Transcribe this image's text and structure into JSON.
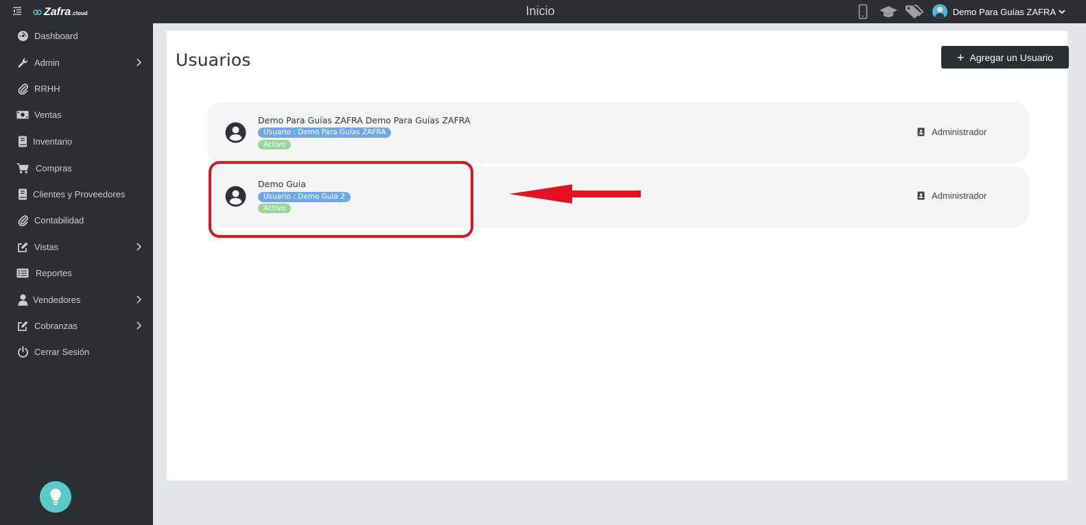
{
  "topbar": {
    "logo_text": "Zafra",
    "logo_suffix": ".cloud",
    "page_heading": "Inicio",
    "icons": [
      "mobile-icon",
      "graduation-cap-icon",
      "tags-icon"
    ],
    "user_name": "Demo Para Guías ZAFRA"
  },
  "sidebar": {
    "items": [
      {
        "label": "Dashboard",
        "icon": "dashboard-icon",
        "has_submenu": false
      },
      {
        "label": "Admin",
        "icon": "wrench-icon",
        "has_submenu": true
      },
      {
        "label": "RRHH",
        "icon": "paperclip-icon",
        "has_submenu": false
      },
      {
        "label": "Ventas",
        "icon": "money-icon",
        "has_submenu": false
      },
      {
        "label": "Inventario",
        "icon": "book-icon",
        "has_submenu": false
      },
      {
        "label": "Compras",
        "icon": "cart-icon",
        "has_submenu": false
      },
      {
        "label": "Clientes y Proveedores",
        "icon": "book-icon",
        "has_submenu": false
      },
      {
        "label": "Contabilidad",
        "icon": "paperclip-icon",
        "has_submenu": false
      },
      {
        "label": "Vistas",
        "icon": "edit-icon",
        "has_submenu": true
      },
      {
        "label": "Reportes",
        "icon": "list-icon",
        "has_submenu": false
      },
      {
        "label": "Vendedores",
        "icon": "user-icon",
        "has_submenu": true
      },
      {
        "label": "Cobranzas",
        "icon": "edit-icon",
        "has_submenu": true
      },
      {
        "label": "Cerrar Sesión",
        "icon": "power-icon",
        "has_submenu": false
      }
    ]
  },
  "main": {
    "title": "Usuarios",
    "add_button_label": "Agregar un Usuario",
    "users": [
      {
        "name": "Demo Para Guías ZAFRA Demo Para Guías ZAFRA",
        "user_badge": "Usuario : Demo Para Guías ZAFRA",
        "status": "Activo",
        "role": "Administrador"
      },
      {
        "name": "Demo Guia",
        "user_badge": "Usuario : Demo Guia 2",
        "status": "Activo",
        "role": "Administrador"
      }
    ]
  },
  "colors": {
    "sidebar_bg": "#2b2e33",
    "user_badge": "#6fa8e8",
    "status_badge": "#9ad69a",
    "annotation": "#e3121e",
    "help_button": "#5bc8c9"
  }
}
